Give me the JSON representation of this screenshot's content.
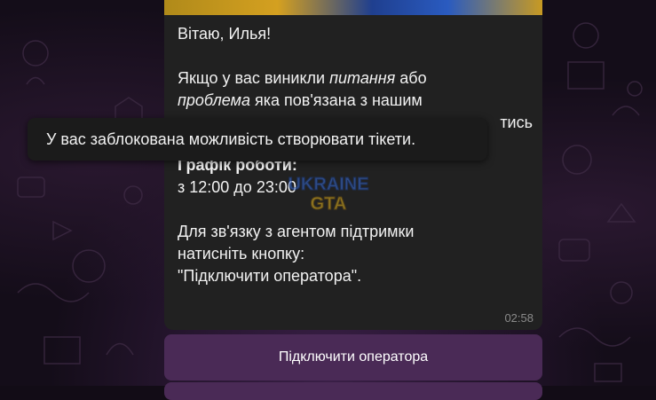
{
  "message": {
    "greeting": "Вітаю, Илья!",
    "p2_part1": "Якщо у вас виникли ",
    "p2_italic1": "питання",
    "p2_part2": " або",
    "p2_italic2": "проблема",
    "p2_part3": " яка пов'язана з нашим",
    "p2_line3_tail": "тись",
    "schedule_label": "Графік роботи:",
    "schedule_hours": "з 12:00 до 23:00",
    "contact_line1": "Для зв'язку з агентом підтримки",
    "contact_line2": "натисніть кнопку:",
    "contact_line3": "\"Підключити оператора\".",
    "time": "02:58"
  },
  "tooltip": {
    "text": "У вас заблокована можливість створювати тікети."
  },
  "keyboard": {
    "connect_operator_label": "Підключити оператора"
  },
  "watermark": {
    "line1": "UKRAINE",
    "line2": "GTA"
  },
  "colors": {
    "bubble": "#212121",
    "button": "#4a2a56",
    "background": "#140d19",
    "accent_blue": "#3a6fd8",
    "accent_yellow": "#e8b820"
  }
}
